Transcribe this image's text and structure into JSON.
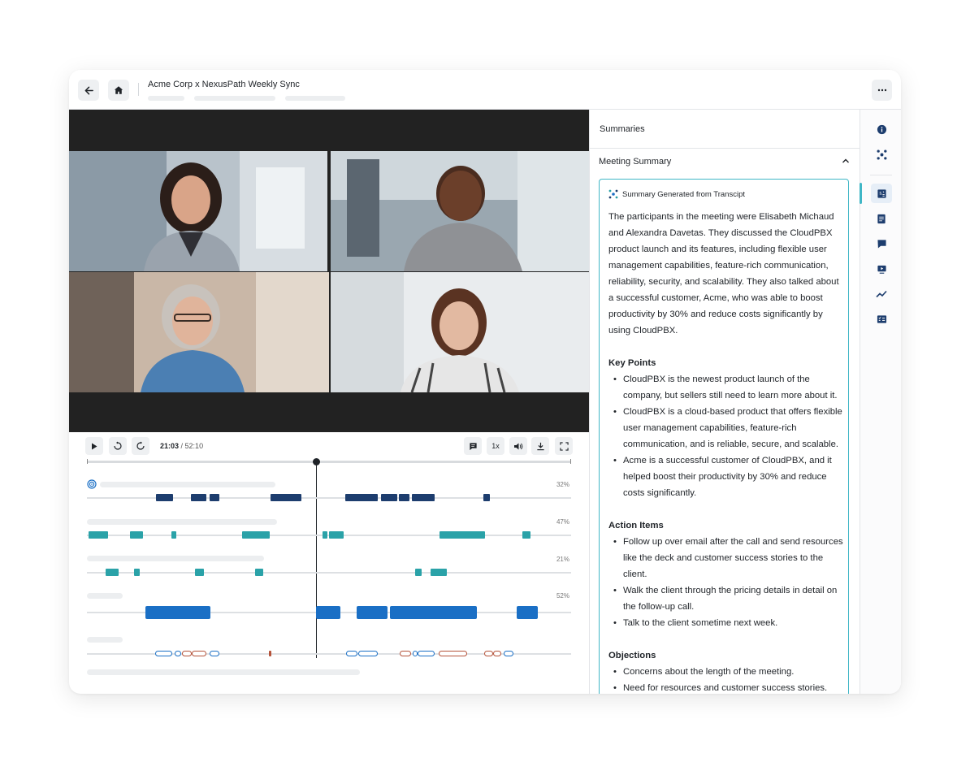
{
  "header": {
    "title": "Acme Corp x NexusPath Weekly Sync"
  },
  "player": {
    "current_time": "21:03",
    "separator": " / ",
    "duration": "52:10",
    "speed_label": "1x",
    "progress_fraction": 0.4034
  },
  "timeline": {
    "speakers": [
      {
        "percent": "32%",
        "color": "#1d3d6e"
      },
      {
        "percent": "47%",
        "color": "#2aa2a8"
      },
      {
        "percent": "21%",
        "color": "#2aa2a8"
      },
      {
        "percent": "52%",
        "color": "#1a6fc5"
      }
    ]
  },
  "summaries": {
    "panel_title": "Summaries",
    "section_title": "Meeting Summary",
    "generated_label": "Summary Generated from Transcipt",
    "overview": "The participants in the meeting were Elisabeth Michaud and Alexandra Davetas. They discussed the CloudPBX product launch and its features, including flexible user management capabilities, feature-rich communication, reliability, security, and scalability. They also talked about a successful customer, Acme, who was able to boost productivity by 30% and reduce costs significantly by using CloudPBX.",
    "key_points_title": "Key Points",
    "key_points": [
      "CloudPBX is the newest product launch of the company, but sellers still need to learn more about it.",
      "CloudPBX is a cloud-based product that offers flexible user management capabilities, feature-rich communication, and is reliable, secure, and scalable.",
      "Acme is a successful customer of CloudPBX, and it helped boost their productivity by 30% and reduce costs significantly."
    ],
    "action_items_title": "Action Items",
    "action_items": [
      "Follow up over email after the call and send resources like the deck and customer success stories to the client.",
      "Walk the client through the pricing details in detail on the follow-up call.",
      "Talk to the client sometime next week."
    ],
    "objections_title": "Objections",
    "objections": [
      "Concerns about the length of the meeting.",
      "Need for resources and customer success stories."
    ]
  },
  "icons": {
    "back": "arrow-left-icon",
    "home": "home-icon",
    "more": "more-horizontal-icon",
    "play": "play-icon",
    "rewind": "rewind-15-icon",
    "forward": "forward-15-icon",
    "comment": "comment-icon",
    "volume": "volume-icon",
    "download": "download-icon",
    "fullscreen": "fullscreen-icon",
    "info": "info-icon",
    "ai": "ai-sparkle-icon",
    "summary": "summary-icon",
    "transcript": "transcript-icon",
    "chat": "chat-icon",
    "video": "video-icon",
    "trend": "trend-icon",
    "checklist": "checklist-icon"
  },
  "colors": {
    "accent": "#3fb6c6",
    "navy": "#1d3d6e",
    "teal": "#2aa2a8",
    "blue": "#1a6fc5"
  }
}
